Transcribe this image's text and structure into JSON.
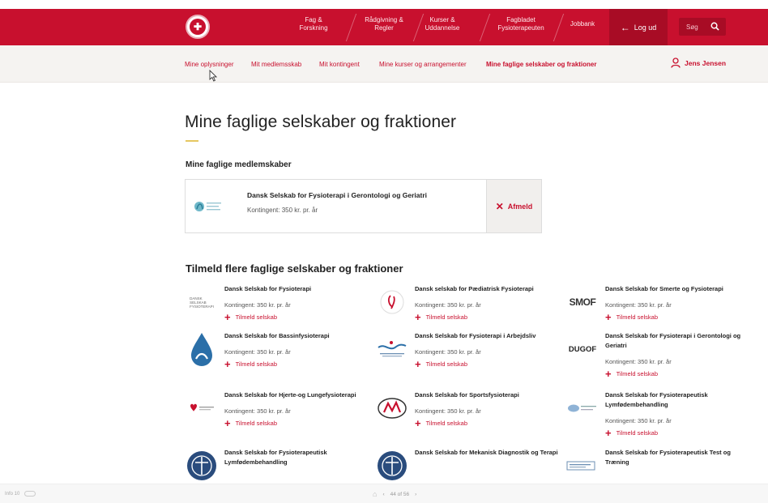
{
  "header": {
    "nav": [
      {
        "label": "Fag &\nForskning"
      },
      {
        "label": "Rådgivning &\nRegler"
      },
      {
        "label": "Kurser &\nUddannelse"
      },
      {
        "label": "Fagbladet\nFysioterapeuten"
      },
      {
        "label": "Jobbank"
      }
    ],
    "logout_label": "Log ud",
    "search_placeholder": "Søg"
  },
  "subnav": {
    "items": [
      {
        "label": "Mine oplysninger"
      },
      {
        "label": "Mit medlemsskab"
      },
      {
        "label": "Mit kontingent"
      },
      {
        "label": "Mine kurser og arrangementer"
      },
      {
        "label": "Mine faglige selskaber og fraktioner"
      }
    ],
    "user_name": "Jens Jensen"
  },
  "main": {
    "title": "Mine faglige selskaber og fraktioner",
    "memberships_heading": "Mine faglige medlemskaber",
    "membership": {
      "name": "Dansk Selskab for Fysioterapi i Gerontologi og Geriatri",
      "fee": "Kontingent: 350 kr. pr. år",
      "unsubscribe_label": "Afmeld"
    },
    "join_heading": "Tilmeld flere faglige selskaber og fraktioner",
    "societies": [
      {
        "name": "Dansk Selskab for Fysioterapi",
        "fee": "Kontingent: 350 kr. pr. år",
        "join": "Tilmeld selskab",
        "logo_text": "DANSK\nSELSKAB\nFYSIOTERAPI"
      },
      {
        "name": "Dansk selskab for Pædiatrisk Fysioterapi",
        "fee": "Kontingent: 350 kr. pr. år",
        "join": "Tilmeld selskab"
      },
      {
        "name": "Dansk Selskab for Smerte og Fysioterapi",
        "fee": "Kontingent: 350 kr. pr. år",
        "join": "Tilmeld selskab",
        "logo_text": "SMOF"
      },
      {
        "name": "Dansk Selskab for Bassinfysioterapi",
        "fee": "Kontingent: 350 kr. pr. år",
        "join": "Tilmeld selskab"
      },
      {
        "name": "Dansk Selskab for Fysioterapi i Arbejdsliv",
        "fee": "Kontingent: 350 kr. pr. år",
        "join": "Tilmeld selskab"
      },
      {
        "name": "Dansk Selskab for Fysioterapi i Gerontologi og Geriatri",
        "fee": "Kontingent: 350 kr. pr. år",
        "join": "Tilmeld selskab",
        "logo_text": "DUGOF"
      },
      {
        "name": "Dansk Selskab for Hjerte-og Lungefysioterapi",
        "fee": "Kontingent: 350 kr. pr. år",
        "join": "Tilmeld selskab"
      },
      {
        "name": "Dansk Selskab for Sportsfysioterapi",
        "fee": "Kontingent: 350 kr. pr. år",
        "join": "Tilmeld selskab"
      },
      {
        "name": "Dansk Selskab for Fysioterapeutisk Lymfødembehandling",
        "fee": "Kontingent: 350 kr. pr. år",
        "join": "Tilmeld selskab"
      },
      {
        "name": "Dansk Selskab for Fysioterapeutisk Lymfødembehandling",
        "fee": "",
        "join": ""
      },
      {
        "name": "Dansk Selskab for Mekanisk Diagnostik og Terapi",
        "fee": "",
        "join": ""
      },
      {
        "name": "Dansk Selskab for Fysioterapeutisk Test og Træning",
        "fee": "",
        "join": ""
      }
    ]
  },
  "viewer": {
    "left_label": "Info 10",
    "page_indicator": "44 of 56"
  },
  "colors": {
    "brand_red": "#c8102e",
    "accent_gold": "#e6c760"
  }
}
